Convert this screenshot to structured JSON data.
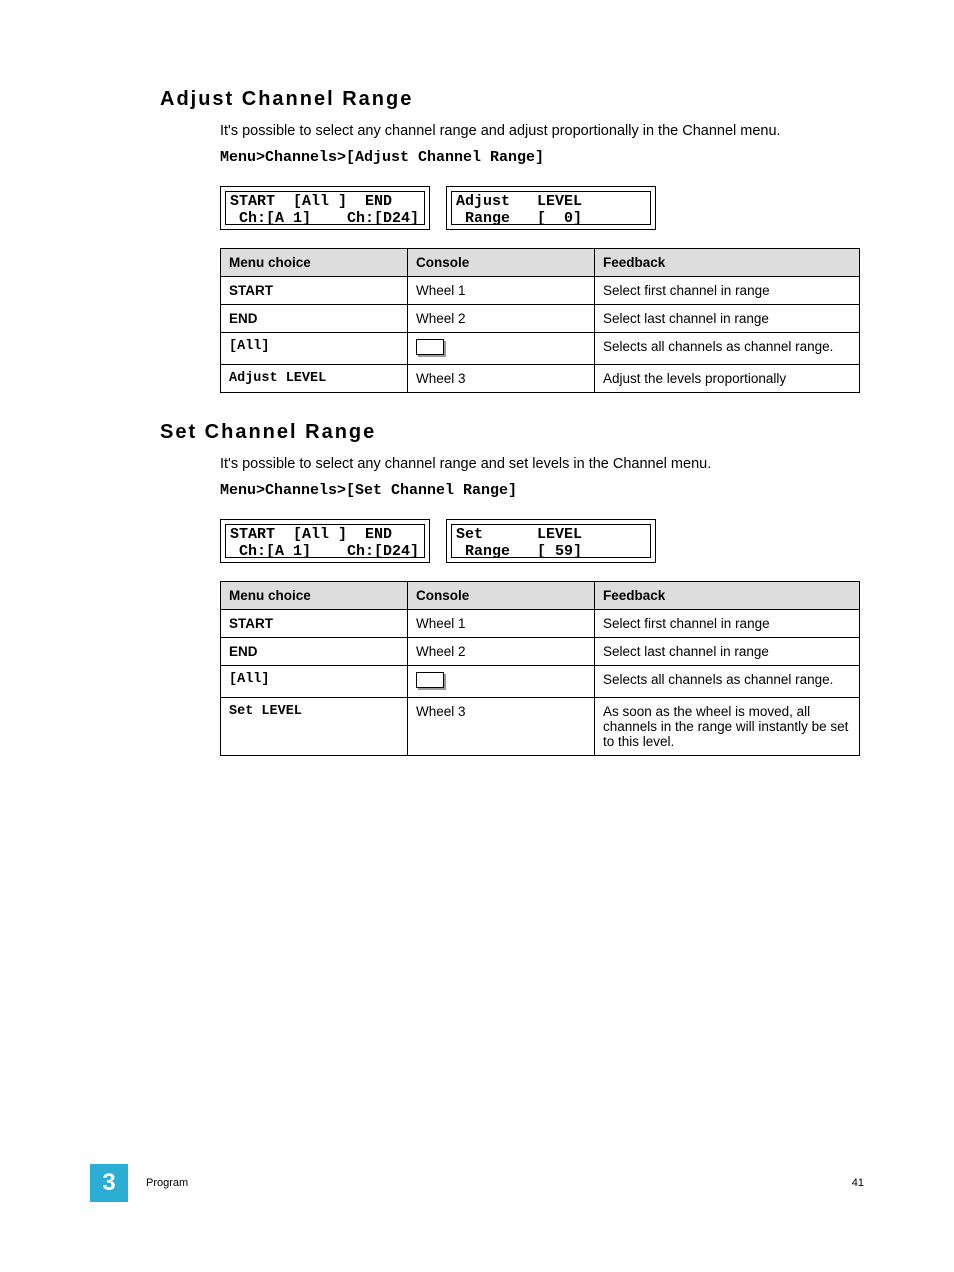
{
  "sections": [
    {
      "heading": "Adjust Channel Range",
      "intro": "It's possible to select any channel range and adjust proportionally in the Channel menu.",
      "menu_path": "Menu>Channels>[Adjust Channel Range]",
      "lcd": [
        "START  [All ]  END\n Ch:[A 1]    Ch:[D24]",
        "Adjust   LEVEL\n Range   [  0]"
      ],
      "table": {
        "headers": [
          "Menu choice",
          "Console",
          "Feedback"
        ],
        "rows": [
          {
            "menu": "START",
            "mono": false,
            "console": "Wheel 1",
            "boxicon": false,
            "feedback": "Select first channel in range"
          },
          {
            "menu": "END",
            "mono": false,
            "console": "Wheel 2",
            "boxicon": false,
            "feedback": "Select last channel in range"
          },
          {
            "menu": "[All]",
            "mono": true,
            "console": "",
            "boxicon": true,
            "feedback": "Selects all channels as channel range."
          },
          {
            "menu": "Adjust LEVEL",
            "mono": true,
            "console": "Wheel 3",
            "boxicon": false,
            "feedback": "Adjust the levels proportionally"
          }
        ]
      }
    },
    {
      "heading": "Set Channel Range",
      "intro": "It's possible to select any channel range and set levels in the Channel menu.",
      "menu_path": "Menu>Channels>[Set Channel Range]",
      "lcd": [
        "START  [All ]  END\n Ch:[A 1]    Ch:[D24]",
        "Set      LEVEL\n Range   [ 59]"
      ],
      "table": {
        "headers": [
          "Menu choice",
          "Console",
          "Feedback"
        ],
        "rows": [
          {
            "menu": "START",
            "mono": false,
            "console": "Wheel 1",
            "boxicon": false,
            "feedback": "Select first channel in range"
          },
          {
            "menu": "END",
            "mono": false,
            "console": "Wheel 2",
            "boxicon": false,
            "feedback": "Select last channel in range"
          },
          {
            "menu": "[All]",
            "mono": true,
            "console": "",
            "boxicon": true,
            "feedback": "Selects all channels as channel range."
          },
          {
            "menu": "Set LEVEL",
            "mono": true,
            "console": "Wheel 3",
            "boxicon": false,
            "feedback": "As soon as the wheel is moved, all channels in the range will instantly be set to this level."
          }
        ]
      }
    }
  ],
  "footer": {
    "chapter_num": "3",
    "chapter_title": "Program",
    "page_num": "41"
  }
}
